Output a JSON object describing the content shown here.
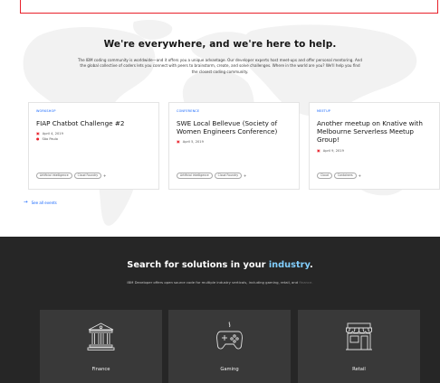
{
  "events_section": {
    "headline": "We're everywhere, and we're here to help.",
    "description": "The IBM coding community is worldwide—and it offers you a unique advantage. Our developer experts host meet-ups and offer personal mentoring. And the global collective of coders lets you connect with peers to brainstorm, create, and solve challenges. Where in the world are you? We'll help you find the closest coding community.",
    "cards": [
      {
        "type": "Workshop",
        "title": "FIAP Chatbot Challenge #2",
        "date": "April 4, 2019",
        "location": "São Paulo",
        "tags": [
          "Artificial intelligence",
          "Cloud Foundry"
        ],
        "more": "+"
      },
      {
        "type": "Conference",
        "title": "SWE Local Bellevue (Society of Women Engineers Conference)",
        "date": "April 5, 2019",
        "tags": [
          "Artificial intelligence",
          "Cloud Foundry"
        ],
        "more": "+"
      },
      {
        "type": "Meetup",
        "title": "Another meetup on Knative with Melbourne Serverless Meetup Group!",
        "date": "April 9, 2019",
        "tags": [
          "Cloud",
          "Containers"
        ],
        "more": "+"
      }
    ],
    "see_all_label": "See all events"
  },
  "industry_section": {
    "title_prefix": "Search for solutions in your ",
    "title_accent": "industry",
    "title_suffix": ".",
    "description": "IBM Developer offers open source code for multiple industry verticals, including gaming, retail, and ",
    "description_fade": "finance.",
    "tiles": [
      {
        "label": "Finance",
        "icon": "bank-icon"
      },
      {
        "label": "Gaming",
        "icon": "gamepad-icon"
      },
      {
        "label": "Retail",
        "icon": "storefront-icon"
      }
    ]
  },
  "colors": {
    "accent_blue": "#0f62fe",
    "accent_light_blue": "#82cfff",
    "dark_bg": "#262626",
    "tile_bg": "#393939",
    "date_icon_red": "#e8202a"
  }
}
